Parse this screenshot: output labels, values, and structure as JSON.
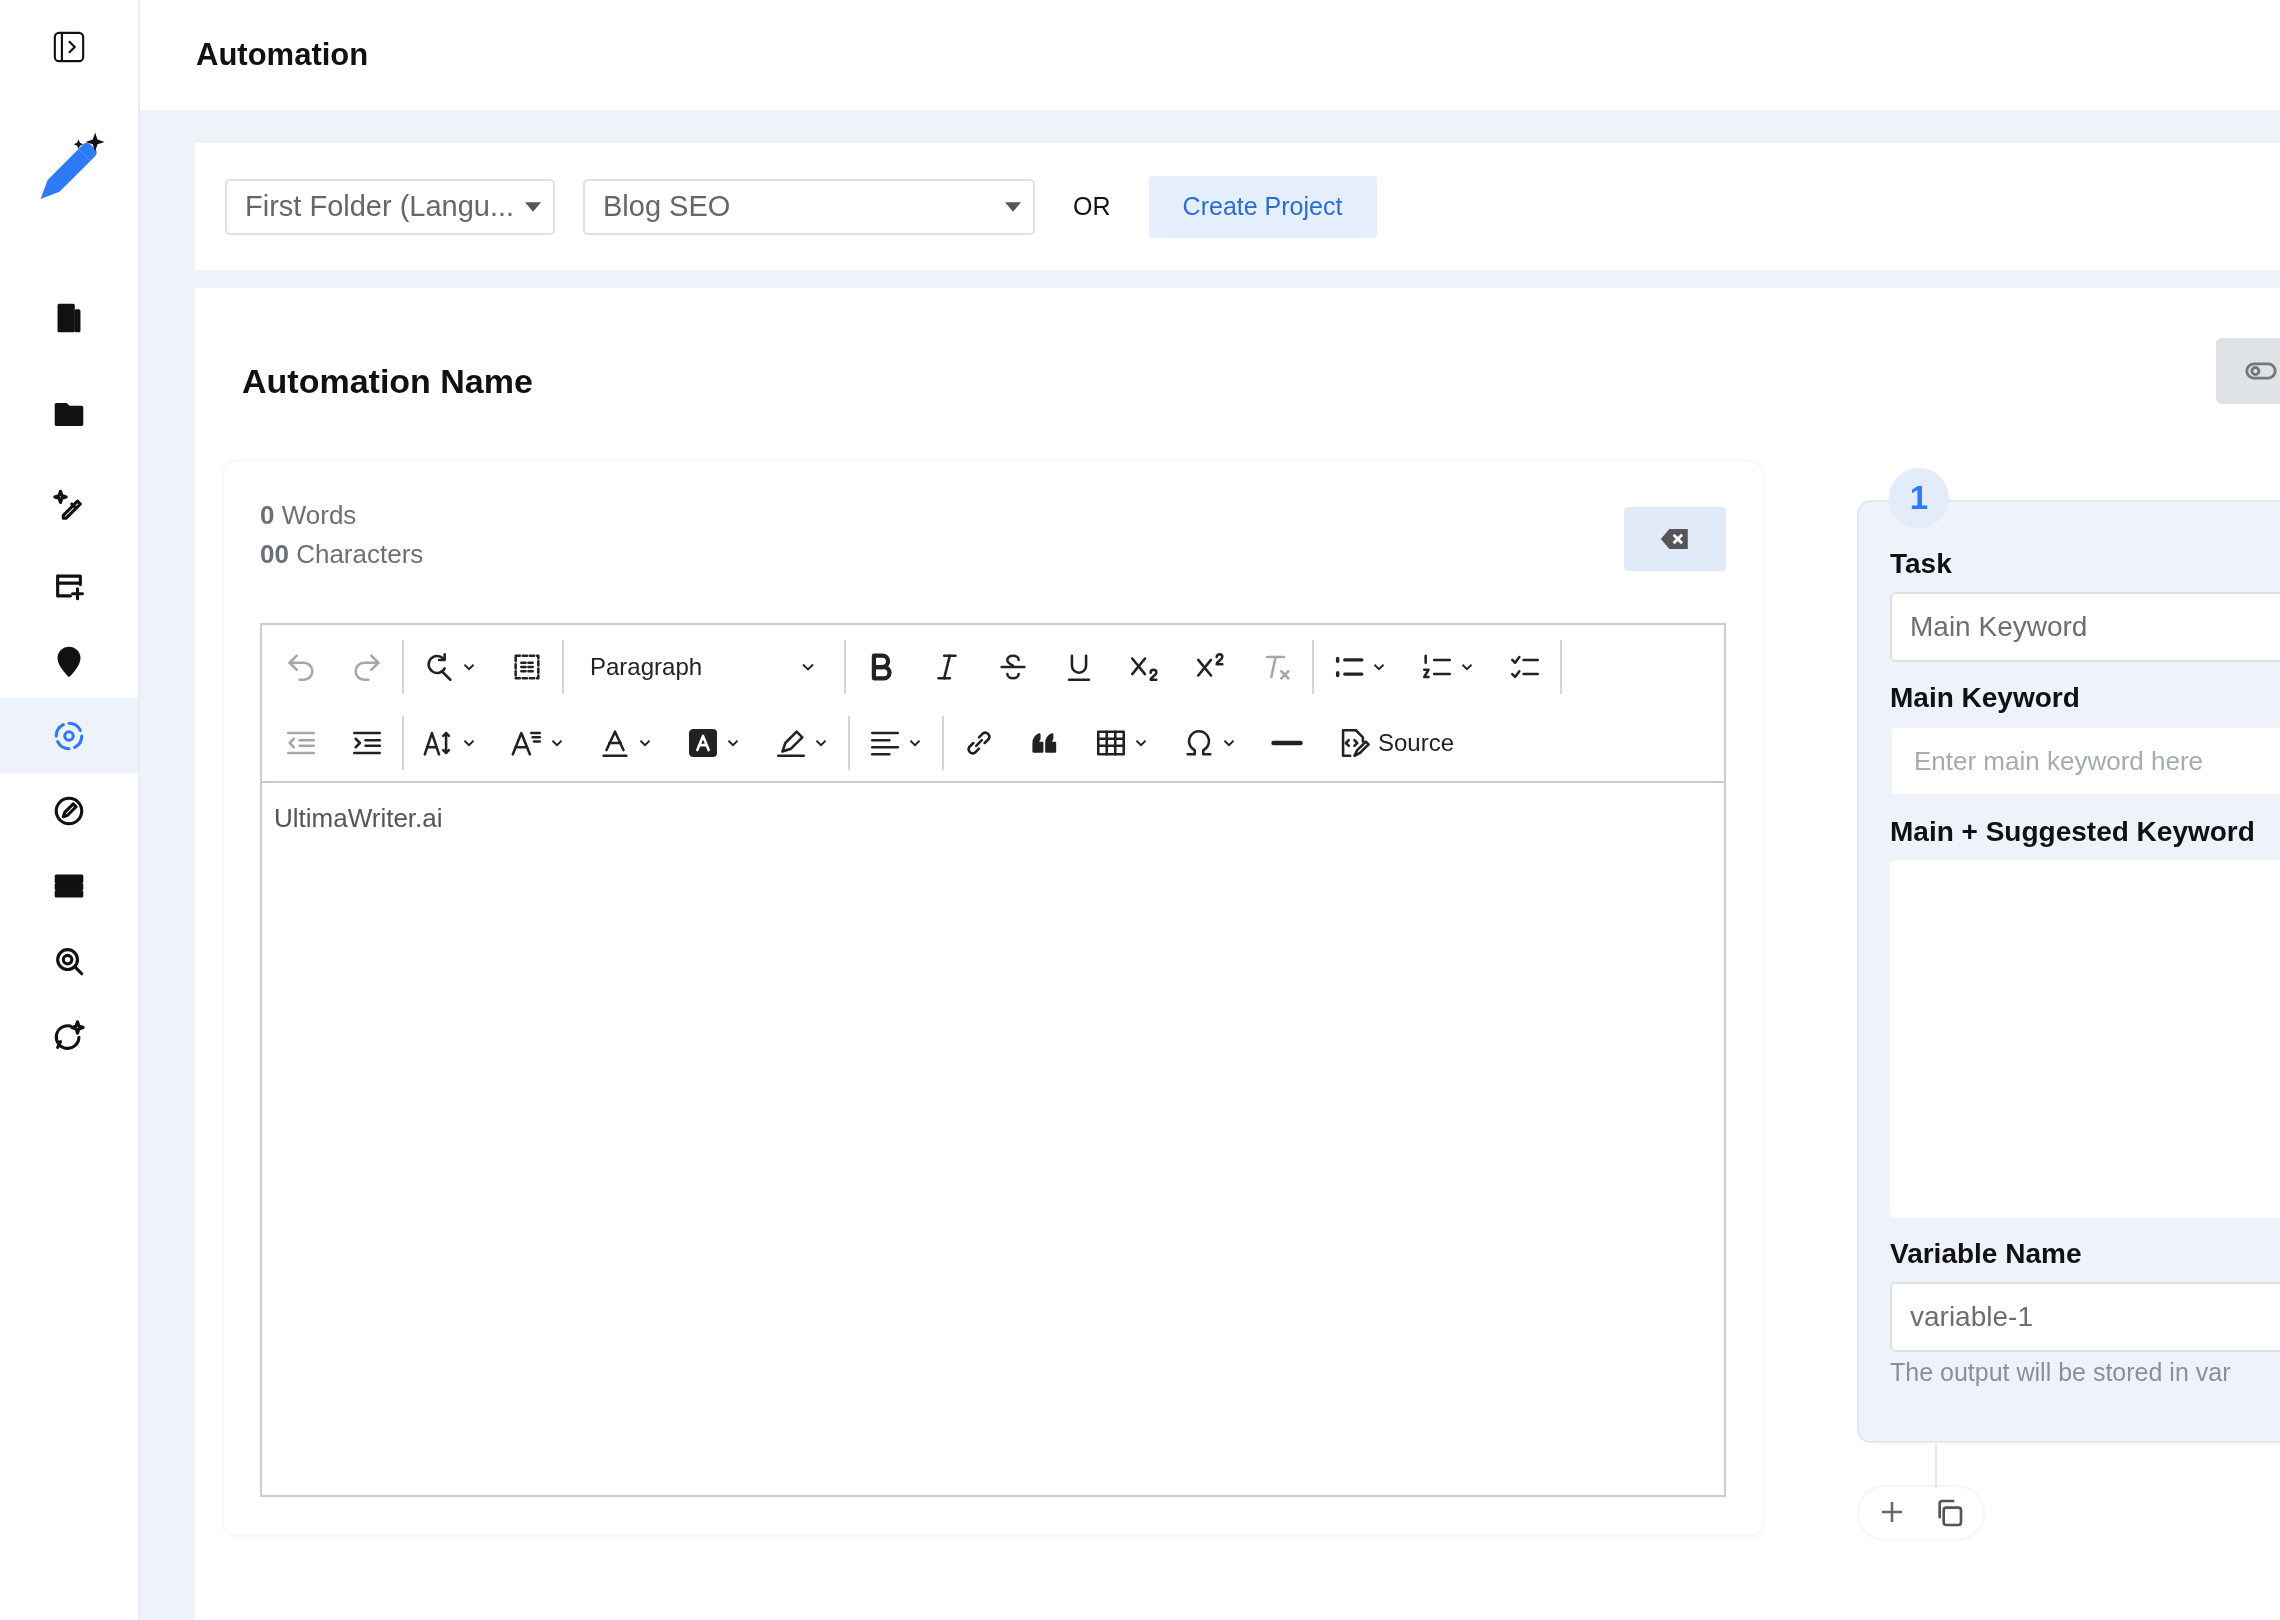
{
  "sidebar": {
    "items": [
      {
        "selected": false
      },
      {
        "selected": false
      },
      {
        "selected": false
      },
      {
        "selected": false
      },
      {
        "selected": false
      },
      {
        "selected": true
      },
      {
        "selected": false
      },
      {
        "selected": false
      },
      {
        "selected": false
      },
      {
        "selected": false
      }
    ]
  },
  "header": {
    "title": "Automation"
  },
  "project_bar": {
    "folder_select": {
      "value": "First Folder (Langu..."
    },
    "template_select": {
      "value": "Blog SEO"
    },
    "separator_text": "OR",
    "create_button": "Create Project"
  },
  "automation": {
    "title": "Automation Name"
  },
  "editor": {
    "word_count": "0",
    "word_label": "Words",
    "char_count": "00",
    "char_label": "Characters",
    "toolbar": [
      [
        [
          {
            "kind": "icon",
            "disabled": true,
            "menu": false
          },
          {
            "kind": "icon",
            "disabled": true,
            "menu": false
          }
        ],
        [
          {
            "kind": "icon",
            "disabled": false,
            "menu": true
          },
          {
            "kind": "icon",
            "disabled": false,
            "menu": false
          }
        ],
        [
          {
            "kind": "select",
            "value": "Paragraph"
          }
        ],
        [
          {
            "kind": "icon",
            "disabled": false,
            "menu": false
          },
          {
            "kind": "icon",
            "disabled": false,
            "menu": false
          },
          {
            "kind": "icon",
            "disabled": false,
            "menu": false
          },
          {
            "kind": "icon",
            "disabled": false,
            "menu": false
          },
          {
            "kind": "icon",
            "disabled": false,
            "menu": false
          },
          {
            "kind": "icon",
            "disabled": false,
            "menu": false
          },
          {
            "kind": "icon",
            "disabled": true,
            "menu": false
          }
        ],
        [
          {
            "kind": "icon",
            "disabled": false,
            "menu": true
          },
          {
            "kind": "icon",
            "disabled": false,
            "menu": true
          },
          {
            "kind": "icon",
            "disabled": false,
            "menu": false
          }
        ]
      ],
      [
        [
          {
            "kind": "icon",
            "disabled": true,
            "menu": false
          },
          {
            "kind": "icon",
            "disabled": false,
            "menu": false
          }
        ],
        [
          {
            "kind": "icon",
            "disabled": false,
            "menu": true
          },
          {
            "kind": "icon",
            "disabled": false,
            "menu": true
          },
          {
            "kind": "icon",
            "disabled": false,
            "menu": true
          },
          {
            "kind": "icon",
            "disabled": false,
            "menu": true
          },
          {
            "kind": "icon",
            "disabled": false,
            "menu": true
          }
        ],
        [
          {
            "kind": "icon",
            "disabled": false,
            "menu": true
          }
        ],
        [
          {
            "kind": "icon",
            "disabled": false,
            "menu": false
          },
          {
            "kind": "icon",
            "disabled": false,
            "menu": false
          },
          {
            "kind": "icon",
            "disabled": false,
            "menu": true
          },
          {
            "kind": "icon",
            "disabled": false,
            "menu": true
          },
          {
            "kind": "icon",
            "disabled": false,
            "menu": false
          },
          {
            "kind": "labeled",
            "label": "Source"
          }
        ]
      ]
    ],
    "content": "UltimaWriter.ai"
  },
  "step": {
    "number": "1",
    "fields": [
      {
        "kind": "input",
        "label": "Task",
        "value": "Main Keyword"
      },
      {
        "kind": "input",
        "label": "Main Keyword",
        "placeholder": "Enter main keyword here"
      },
      {
        "kind": "textarea",
        "label": "Main + Suggested Keyword"
      },
      {
        "kind": "input",
        "label": "Variable Name",
        "value": "variable-1",
        "help": "The output will be stored in var"
      }
    ]
  }
}
